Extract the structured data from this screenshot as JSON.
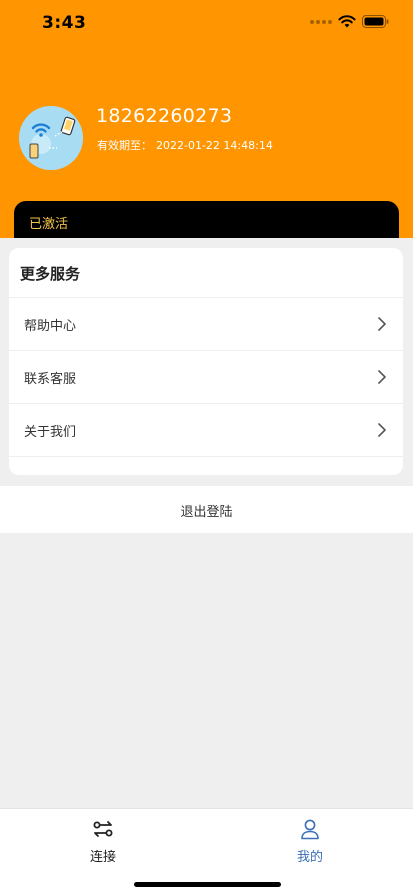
{
  "status_bar": {
    "time": "3:43",
    "icons": [
      "signal-dots-icon",
      "wifi-icon",
      "battery-icon"
    ]
  },
  "profile": {
    "phone": "18262260273",
    "expiry_label": "有效期至：",
    "expiry_value": "2022-01-22 14:48:14",
    "avatar_icon": "wifi-transfer-illustration"
  },
  "membership": {
    "status": "已激活"
  },
  "services": {
    "title": "更多服务",
    "items": [
      {
        "label": "帮助中心",
        "icon": "chevron-right-icon"
      },
      {
        "label": "联系客服",
        "icon": "chevron-right-icon"
      },
      {
        "label": "关于我们",
        "icon": "chevron-right-icon"
      }
    ]
  },
  "logout": {
    "label": "退出登陆"
  },
  "tab_bar": {
    "tabs": [
      {
        "label": "连接",
        "icon": "connect-icon",
        "active": false
      },
      {
        "label": "我的",
        "icon": "user-icon",
        "active": true
      }
    ]
  },
  "colors": {
    "brand_orange": "#FF9500",
    "activated_gold": "#F5C54A",
    "tab_active": "#3B6FB6",
    "tab_inactive": "#222222"
  }
}
